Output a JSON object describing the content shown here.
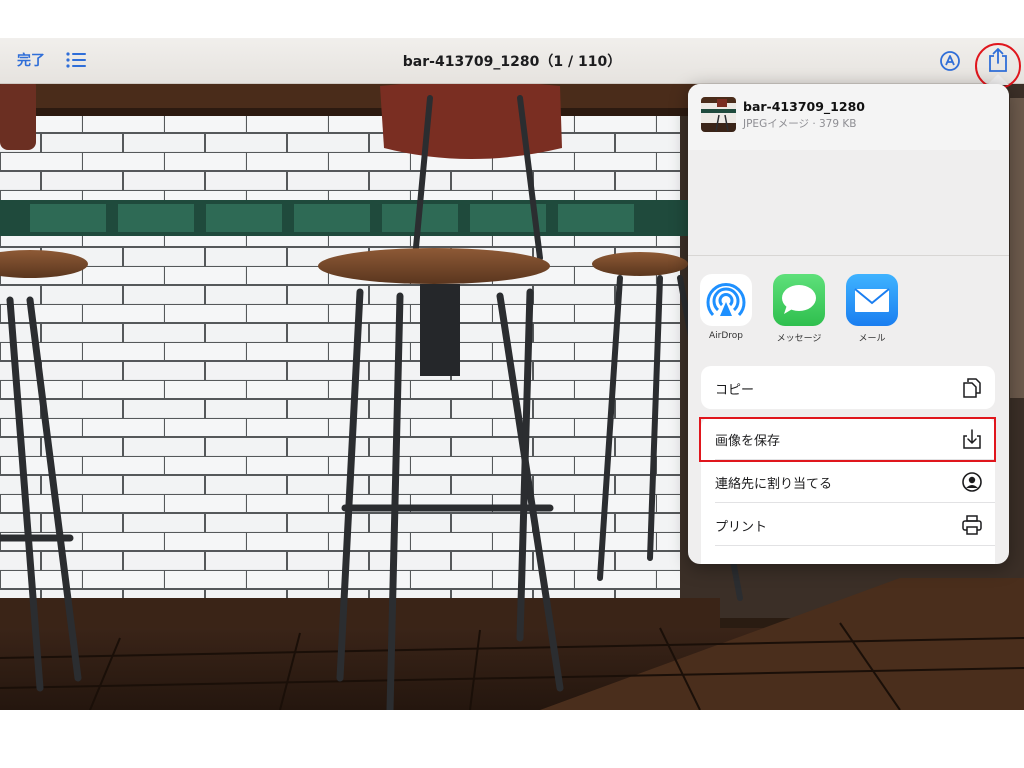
{
  "nav": {
    "done_label": "完了",
    "title": "bar-413709_1280（1 / 110）"
  },
  "icons": {
    "list": "list-icon",
    "markup": "markup-icon",
    "share": "share-icon"
  },
  "share_sheet": {
    "file_name": "bar-413709_1280",
    "file_info": "JPEGイメージ · 379 KB",
    "apps": [
      {
        "label": "AirDrop",
        "icon": "airdrop-icon",
        "color": "#1e90ff"
      },
      {
        "label": "メッセージ",
        "icon": "messages-icon",
        "color": "#34c759"
      },
      {
        "label": "メール",
        "icon": "mail-icon",
        "color": "#1a8cf5"
      }
    ],
    "actions": [
      {
        "label": "コピー",
        "icon": "copy-icon"
      },
      {
        "label": "画像を保存",
        "icon": "save-image-icon"
      },
      {
        "label": "連絡先に割り当てる",
        "icon": "contact-icon"
      },
      {
        "label": "プリント",
        "icon": "print-icon"
      }
    ]
  },
  "colors": {
    "accent": "#2f6ed8",
    "highlight": "#e0161d"
  }
}
